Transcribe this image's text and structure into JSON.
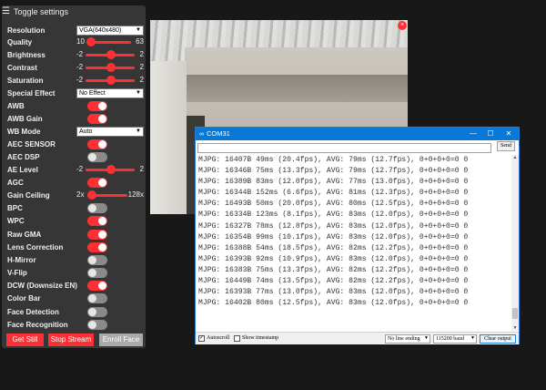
{
  "panel": {
    "title": "Toggle settings",
    "resolution": {
      "label": "Resolution",
      "value": "VGA(640x480)"
    },
    "quality": {
      "label": "Quality",
      "min": "10",
      "max": "63",
      "value": 10
    },
    "brightness": {
      "label": "Brightness",
      "min": "-2",
      "max": "2",
      "value": 0
    },
    "contrast": {
      "label": "Contrast",
      "min": "-2",
      "max": "2",
      "value": 0
    },
    "saturation": {
      "label": "Saturation",
      "min": "-2",
      "max": "2",
      "value": 0
    },
    "special_effect": {
      "label": "Special Effect",
      "value": "No Effect"
    },
    "awb": {
      "label": "AWB",
      "on": true
    },
    "awb_gain": {
      "label": "AWB Gain",
      "on": true
    },
    "wb_mode": {
      "label": "WB Mode",
      "value": "Auto"
    },
    "aec_sensor": {
      "label": "AEC SENSOR",
      "on": true
    },
    "aec_dsp": {
      "label": "AEC DSP",
      "on": false
    },
    "ae_level": {
      "label": "AE Level",
      "min": "-2",
      "max": "2",
      "value": 0
    },
    "agc": {
      "label": "AGC",
      "on": true
    },
    "gain_ceiling": {
      "label": "Gain Ceiling",
      "min": "2x",
      "max": "128x",
      "value": 0
    },
    "bpc": {
      "label": "BPC",
      "on": false
    },
    "wpc": {
      "label": "WPC",
      "on": true
    },
    "raw_gma": {
      "label": "Raw GMA",
      "on": true
    },
    "lens_correction": {
      "label": "Lens Correction",
      "on": true
    },
    "h_mirror": {
      "label": "H-Mirror",
      "on": false
    },
    "v_flip": {
      "label": "V-Flip",
      "on": false
    },
    "dcw": {
      "label": "DCW (Downsize EN)",
      "on": true
    },
    "color_bar": {
      "label": "Color Bar",
      "on": false
    },
    "face_detection": {
      "label": "Face Detection",
      "on": false
    },
    "face_recognition": {
      "label": "Face Recognition",
      "on": false
    },
    "buttons": {
      "get_still": "Get Still",
      "stop_stream": "Stop Stream",
      "enroll_face": "Enroll Face"
    }
  },
  "camera": {
    "close_glyph": "×"
  },
  "serial": {
    "title": "COM31",
    "send_label": "Send",
    "log_lines": [
      "MJPG: 16407B 49ms (20.4fps), AVG: 79ms (12.7fps), 0+0+0+0=0 0",
      "MJPG: 16346B 75ms (13.3fps), AVG: 79ms (12.7fps), 0+0+0+0=0 0",
      "MJPG: 16389B 83ms (12.0fps), AVG: 77ms (13.0fps), 0+0+0+0=0 0",
      "MJPG: 16344B 152ms (6.6fps), AVG: 81ms (12.3fps), 0+0+0+0=0 0",
      "MJPG: 16493B 50ms (20.0fps), AVG: 80ms (12.5fps), 0+0+0+0=0 0",
      "MJPG: 16334B 123ms (8.1fps), AVG: 83ms (12.0fps), 0+0+0+0=0 0",
      "MJPG: 16327B 78ms (12.8fps), AVG: 83ms (12.0fps), 0+0+0+0=0 0",
      "MJPG: 16354B 99ms (10.1fps), AVG: 83ms (12.0fps), 0+0+0+0=0 0",
      "MJPG: 16388B 54ms (18.5fps), AVG: 82ms (12.2fps), 0+0+0+0=0 0",
      "MJPG: 16393B 92ms (10.9fps), AVG: 83ms (12.0fps), 0+0+0+0=0 0",
      "MJPG: 16383B 75ms (13.3fps), AVG: 82ms (12.2fps), 0+0+0+0=0 0",
      "MJPG: 16449B 74ms (13.5fps), AVG: 82ms (12.2fps), 0+0+0+0=0 0",
      "MJPG: 16393B 77ms (13.0fps), AVG: 83ms (12.0fps), 0+0+0+0=0 0",
      "MJPG: 16402B 80ms (12.5fps), AVG: 83ms (12.0fps), 0+0+0+0=0 0"
    ],
    "autoscroll": {
      "label": "Autoscroll",
      "checked": true
    },
    "timestamp": {
      "label": "Show timestamp",
      "checked": false
    },
    "line_ending": "No line ending",
    "baud": "115200 baud",
    "clear_label": "Clear output"
  },
  "colors": {
    "accent": "#ff3034",
    "panel_bg": "#363636",
    "titlebar": "#0a78d7"
  }
}
